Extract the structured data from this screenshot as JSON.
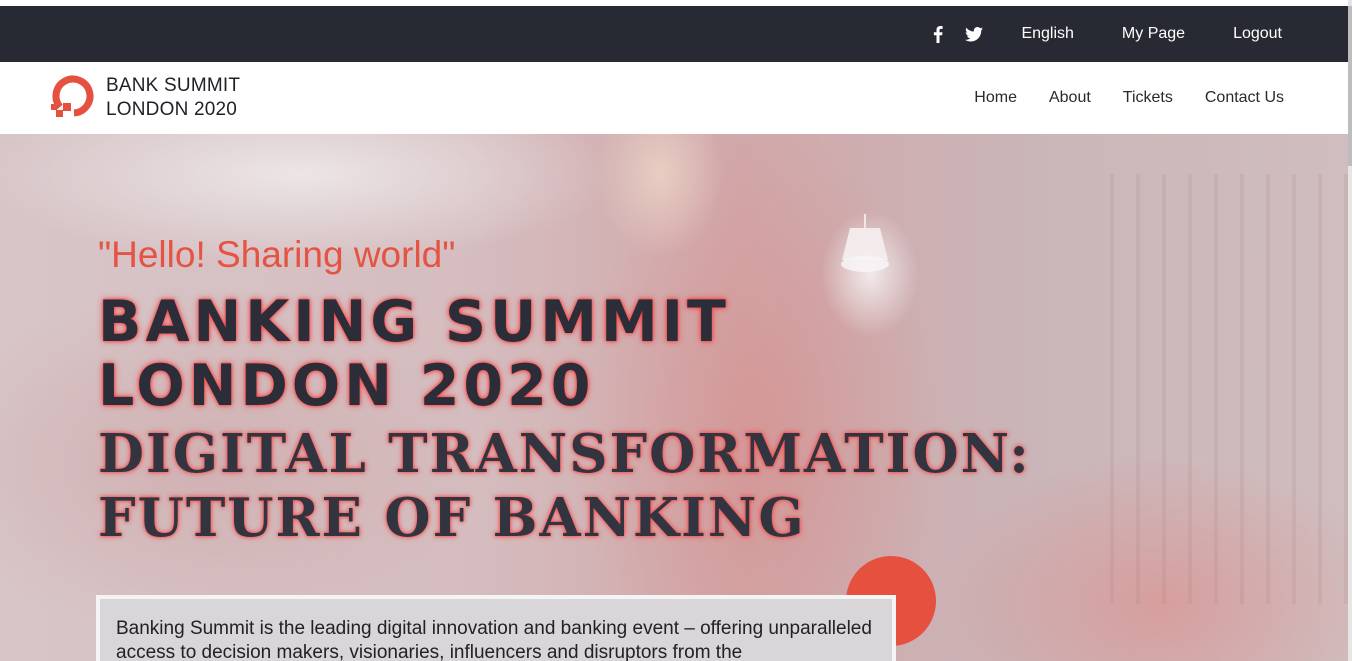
{
  "topbar": {
    "social": [
      {
        "icon": "facebook-icon"
      },
      {
        "icon": "twitter-icon"
      }
    ],
    "language": "English",
    "my_page": "My Page",
    "logout": "Logout"
  },
  "brand": {
    "line1": "BANK SUMMIT",
    "line2": "LONDON 2020",
    "logo_icon": "logo-icon"
  },
  "nav": {
    "items": [
      {
        "label": "Home"
      },
      {
        "label": "About"
      },
      {
        "label": "Tickets"
      },
      {
        "label": "Contact Us"
      }
    ]
  },
  "hero": {
    "quote": "\"Hello! Sharing world\"",
    "headline_line1": "BANKING SUMMIT",
    "headline_line2": "LONDON 2020",
    "subhead_line1": "DIGITAL TRANSFORMATION:",
    "subhead_line2": "FUTURE OF BANKING",
    "intro": "Banking Summit is the leading digital innovation and banking event – offering unparalleled access to decision makers, visionaries, influencers and disruptors from the"
  },
  "colors": {
    "topbar_bg": "#272a32",
    "accent": "#e5503f",
    "headline_text": "#2b2d39"
  }
}
